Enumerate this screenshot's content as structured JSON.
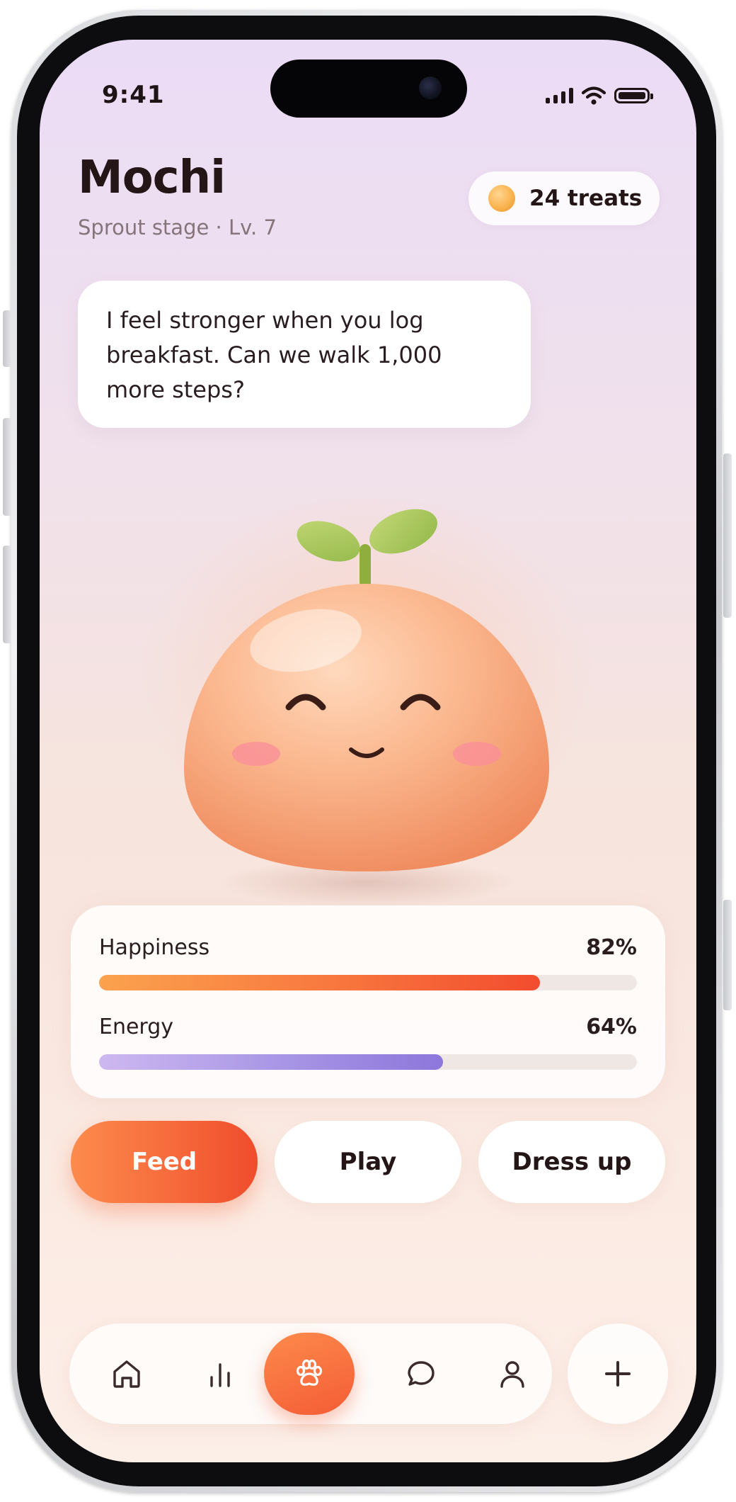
{
  "status_bar": {
    "time": "9:41"
  },
  "pet": {
    "name": "Mochi",
    "subtitle": "Sprout stage · Lv. 7",
    "message": "I feel stronger when you log breakfast. Can we walk 1,000 more steps?"
  },
  "treats": {
    "label": "24 treats",
    "icon": "coin-icon"
  },
  "stats": [
    {
      "label": "Happiness",
      "value_text": "82%",
      "value": 0.82
    },
    {
      "label": "Energy",
      "value_text": "64%",
      "value": 0.64
    }
  ],
  "actions": {
    "feed": "Feed",
    "play": "Play",
    "dress_up": "Dress up"
  },
  "nav": {
    "items": [
      "home-icon",
      "stats-icon",
      "paw-icon",
      "chat-icon",
      "profile-icon"
    ],
    "active": "paw-icon",
    "fab_icon": "plus-icon"
  },
  "colors": {
    "accent": "#f66a3b",
    "happiness_bar": "#f24c2e",
    "energy_bar": "#8d77db",
    "pet_body": "#f9a578",
    "sprout": "#a8c75a"
  }
}
